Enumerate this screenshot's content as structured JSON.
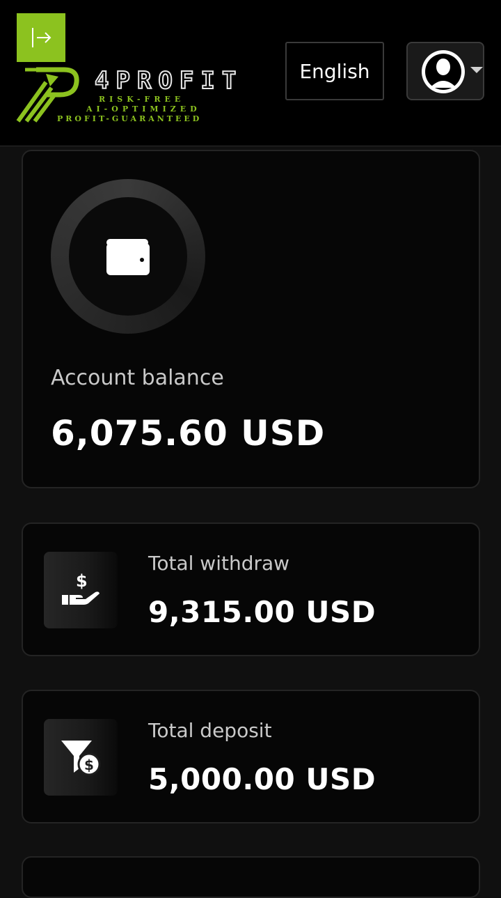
{
  "header": {
    "logo": {
      "word": "4PROFIT",
      "tagline_1": "RISK-FREE",
      "tagline_2": "AI-OPTIMIZED",
      "tagline_3": "PROFIT-GUARANTEED"
    },
    "language_label": "English",
    "sidebar_toggle_icon": "collapse-sidebar-icon",
    "user_icon": "user-avatar-icon"
  },
  "balance": {
    "label": "Account balance",
    "value": "6,075.60 USD",
    "icon": "wallet-icon"
  },
  "stats": {
    "withdraw": {
      "label": "Total withdraw",
      "value": "9,315.00 USD",
      "icon": "hand-dollar-icon"
    },
    "deposit": {
      "label": "Total deposit",
      "value": "5,000.00 USD",
      "icon": "filter-dollar-icon"
    }
  },
  "colors": {
    "accent": "#8cc21f",
    "background": "#101010",
    "card": "#060606",
    "text": "#ffffff",
    "muted_text": "#c9c9c9"
  }
}
